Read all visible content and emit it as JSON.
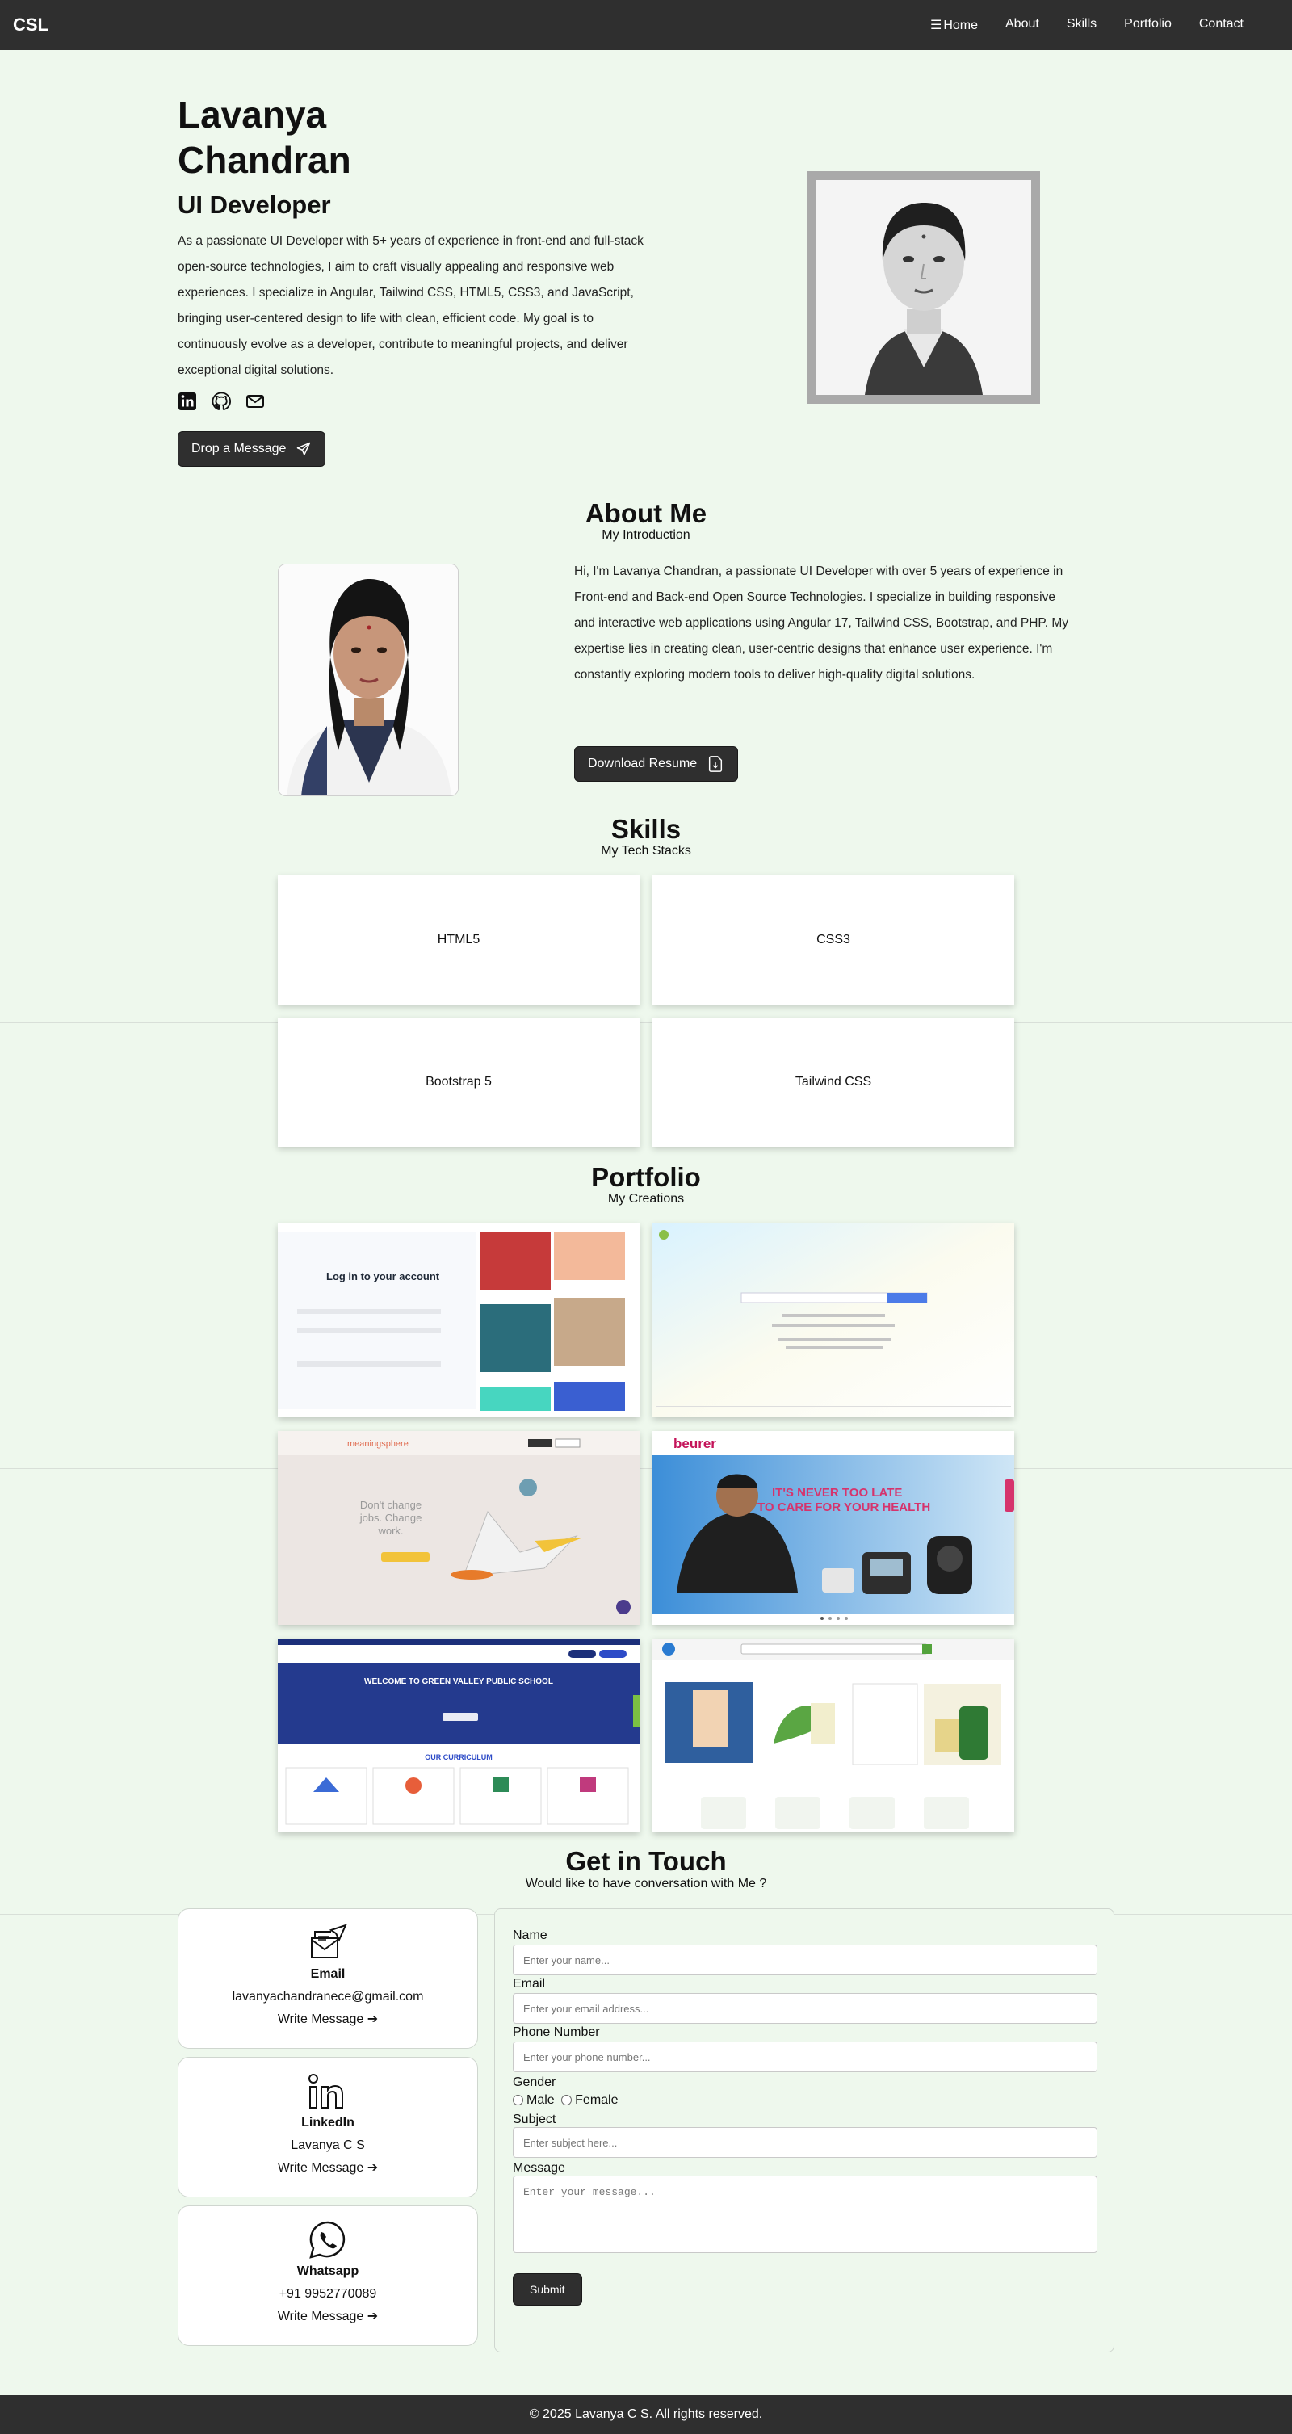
{
  "nav": {
    "brand": "CSL",
    "items": [
      "Home",
      "About",
      "Skills",
      "Portfolio",
      "Contact"
    ]
  },
  "hero": {
    "name": "Lavanya Chandran",
    "role": "UI Developer",
    "intro": "As a passionate UI Developer with 5+ years of experience in front-end and full-stack open-source technologies, I aim to craft visually appealing and responsive web experiences. I specialize in Angular, Tailwind CSS, HTML5, CSS3, and JavaScript, bringing user-centered design to life with clean, efficient code. My goal is to continuously evolve as a developer, contribute to meaningful projects, and deliver exceptional digital solutions.",
    "social_icons": [
      "linkedin-icon",
      "github-icon",
      "mail-icon"
    ],
    "cta": "Drop a Message"
  },
  "about": {
    "title": "About Me",
    "subtitle": "My Introduction",
    "text": "Hi, I'm Lavanya Chandran, a passionate UI Developer with over 5 years of experience in Front-end and Back-end Open Source Technologies. I specialize in building responsive and interactive web applications using Angular 17, Tailwind CSS, Bootstrap, and PHP. My expertise lies in creating clean, user-centric designs that enhance user experience. I'm constantly exploring modern tools to deliver high-quality digital solutions.",
    "cta": "Download Resume"
  },
  "skills": {
    "title": "Skills",
    "subtitle": "My Tech Stacks",
    "items": [
      "HTML5",
      "CSS3",
      "Bootstrap 5",
      "Tailwind CSS"
    ]
  },
  "portfolio": {
    "title": "Portfolio",
    "subtitle": "My Creations",
    "shots": {
      "login_heading": "Log in to your account",
      "ms_tagline": "Don't change jobs. Change work.",
      "ms_brand": "meaningsphere",
      "beurer_brand": "beurer",
      "beurer_headline_1": "IT'S NEVER TOO LATE",
      "beurer_headline_2": "TO CARE FOR YOUR HEALTH",
      "school_headline": "WELCOME TO GREEN VALLEY PUBLIC SCHOOL",
      "school_curriculum": "OUR CURRICULUM"
    }
  },
  "contact": {
    "title": "Get in Touch",
    "subtitle": "Would like to have conversation with Me ?",
    "cards": [
      {
        "label": "Email",
        "value": "lavanyachandranece@gmail.com",
        "link": "Write Message",
        "icon": "email-send-icon"
      },
      {
        "label": "LinkedIn",
        "value": "Lavanya C S",
        "link": "Write Message",
        "icon": "linkedin-icon"
      },
      {
        "label": "Whatsapp",
        "value": "+91 9952770089",
        "link": "Write Message",
        "icon": "whatsapp-icon"
      }
    ],
    "form": {
      "name_label": "Name",
      "name_ph": "Enter your name...",
      "email_label": "Email",
      "email_ph": "Enter your email address...",
      "phone_label": "Phone Number",
      "phone_ph": "Enter your phone number...",
      "gender_label": "Gender",
      "male": "Male",
      "female": "Female",
      "subject_label": "Subject",
      "subject_ph": "Enter subject here...",
      "message_label": "Message",
      "message_ph": "Enter your message...",
      "submit": "Submit"
    }
  },
  "footer": {
    "text": "© 2025 Lavanya C S. All rights reserved."
  }
}
